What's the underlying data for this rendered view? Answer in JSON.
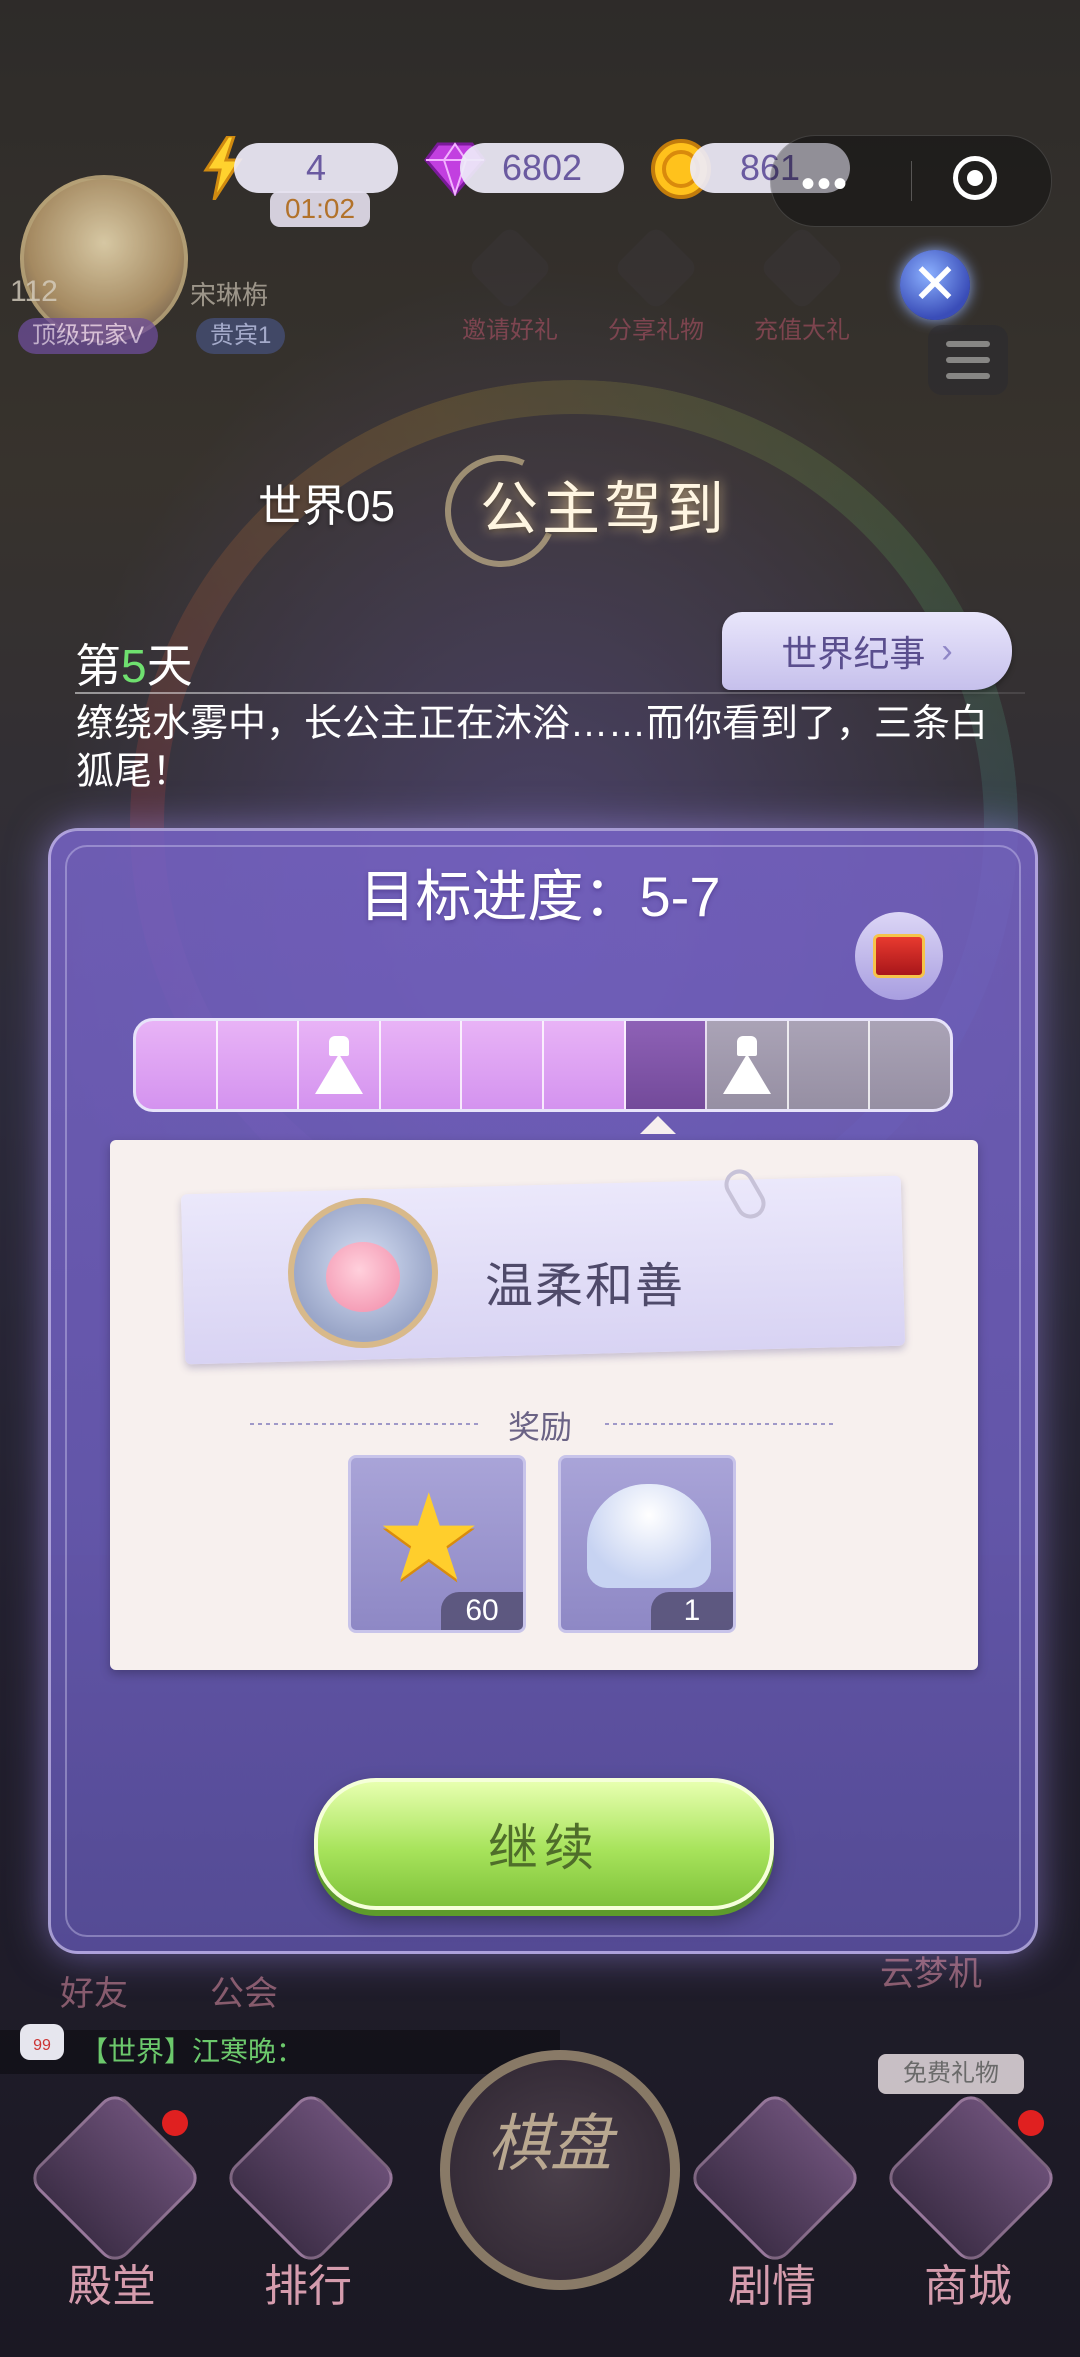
{
  "hud": {
    "energy_value": "4",
    "energy_timer": "01:02",
    "gems_value": "6802",
    "coins_value": "861",
    "capsule_dots": "•••"
  },
  "player": {
    "level": "112",
    "name": "宋琳栴",
    "vip_tag": "顶级玩家V",
    "guest_tag": "贵宾1"
  },
  "top_menu": [
    {
      "label": "邀请好礼"
    },
    {
      "label": "分享礼物"
    },
    {
      "label": "充值大礼"
    }
  ],
  "header": {
    "world_label": "世界05",
    "world_title": "公主驾到"
  },
  "story": {
    "day_prefix": "第",
    "day_number": "5",
    "day_suffix": "天",
    "chronicle_button": "世界纪事",
    "text": "缭绕水雾中，长公主正在沐浴……而你看到了，三条白狐尾！"
  },
  "goal": {
    "label": "目标进度：5-7",
    "progress_cells": [
      {
        "state": "done",
        "icon": ""
      },
      {
        "state": "done",
        "icon": ""
      },
      {
        "state": "done",
        "icon": "dress-icon"
      },
      {
        "state": "done",
        "icon": ""
      },
      {
        "state": "done",
        "icon": ""
      },
      {
        "state": "done",
        "icon": ""
      },
      {
        "state": "current",
        "icon": ""
      },
      {
        "state": "todo",
        "icon": "dress-icon"
      },
      {
        "state": "todo",
        "icon": ""
      },
      {
        "state": "todo",
        "icon": ""
      }
    ]
  },
  "trait": {
    "name": "温柔和善"
  },
  "rewards": {
    "title": "奖励",
    "items": [
      {
        "icon": "star-icon",
        "count": "60"
      },
      {
        "icon": "shell-icon",
        "count": "1"
      }
    ]
  },
  "continue_button": "继续",
  "background_labels": {
    "friends": "好友",
    "guild": "公会",
    "cloud_machine": "云梦机",
    "chat_channel": "【世界】江寒晚：",
    "chat_badge": "99",
    "free_gift": "免费礼物",
    "center_button": "棋盘"
  },
  "bottom_nav": [
    {
      "label": "殿堂",
      "has_dot": true
    },
    {
      "label": "排行",
      "has_dot": false
    },
    {
      "label": "剧情",
      "has_dot": false
    },
    {
      "label": "商城",
      "has_dot": true
    }
  ],
  "colors": {
    "accent_green": "#6fe06f",
    "panel_purple": "#7a68c4",
    "button_green": "#a7e35b"
  }
}
